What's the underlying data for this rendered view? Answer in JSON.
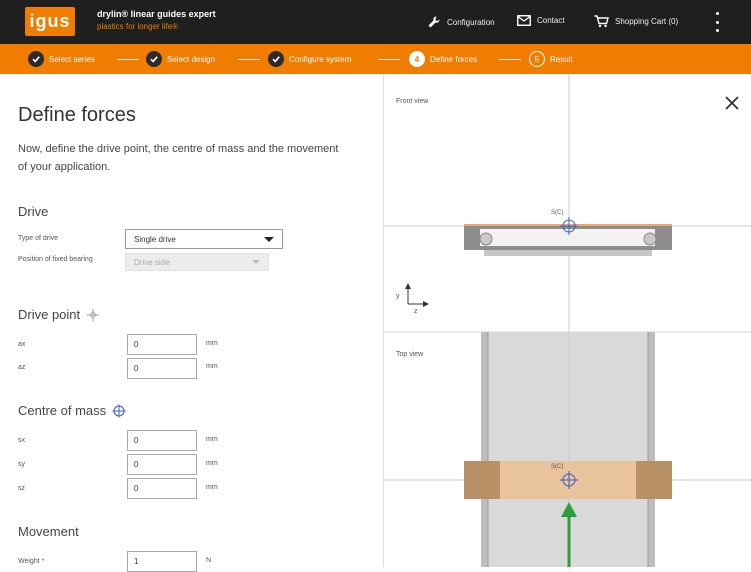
{
  "header": {
    "logo": "igus",
    "brand_title": "drylin® linear guides expert",
    "brand_subtitle": "plastics for longer life®",
    "nav": [
      {
        "label": "Configuration",
        "icon": "wrench-icon"
      },
      {
        "label": "Contact",
        "icon": "mail-icon"
      },
      {
        "label": "Shopping Cart (0)",
        "icon": "cart-icon"
      }
    ],
    "menu_icon": "kebab-menu-icon"
  },
  "steps": [
    {
      "label": "Select series",
      "state": "done"
    },
    {
      "label": "Select design",
      "state": "done"
    },
    {
      "label": "Configure system",
      "state": "done"
    },
    {
      "label": "Define forces",
      "state": "current",
      "number": "4"
    },
    {
      "label": "Result",
      "state": "future",
      "number": "5"
    }
  ],
  "form": {
    "title": "Define forces",
    "intro": "Now, define the drive point, the centre of mass and the movement of your application.",
    "drive": {
      "heading": "Drive",
      "type_label": "Type of drive",
      "type_value": "Single drive",
      "fixed_label": "Position of fixed bearing",
      "fixed_value": "Drive side"
    },
    "drive_point": {
      "heading": "Drive point",
      "fields": [
        {
          "label": "ax",
          "value": "0",
          "unit": "mm"
        },
        {
          "label": "az",
          "value": "0",
          "unit": "mm"
        }
      ]
    },
    "centre_of_mass": {
      "heading": "Centre of mass",
      "fields": [
        {
          "label": "sx",
          "value": "0",
          "unit": "mm"
        },
        {
          "label": "sy",
          "value": "0",
          "unit": "mm"
        },
        {
          "label": "sz",
          "value": "0",
          "unit": "mm"
        }
      ]
    },
    "movement": {
      "heading": "Movement",
      "weight_label": "Weight *",
      "weight_value": "1",
      "weight_unit": "N"
    }
  },
  "views": {
    "front_label": "Front view",
    "top_label": "Top view",
    "axis_y": "y",
    "axis_z": "z",
    "cog_label_front": "S(C)",
    "cog_label_top": "S(C)",
    "close_icon": "close-icon"
  },
  "colors": {
    "accent": "#f07d00",
    "header_bg": "#1f1f1f",
    "step_done": "#2b2b2b",
    "carriage": "#d4a67a",
    "arrow": "#2e9e3a"
  }
}
